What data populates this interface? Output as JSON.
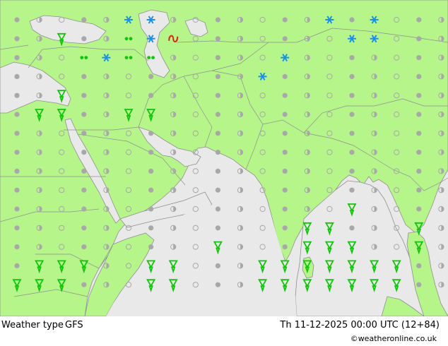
{
  "map": {
    "title": "Weather type",
    "model": "GFS",
    "valid_time": "Th 11-12-2025 00:00 UTC (12+84)",
    "copyright": "©weatheronline.co.uk",
    "colors": {
      "land": "#b6f58a",
      "sea": "#e9e9e9",
      "border": "#9a9a9a",
      "dot": "#a8a8a8",
      "rain": "#12c40c",
      "snow": "#1a8fe6",
      "thunder": "#d02b0b"
    },
    "symbol_legend": {
      "overcast": "filled-grey-dot",
      "cloudy": "half-grey-dot",
      "clear": "open-grey-circle",
      "rain": "green-raindrop-icon",
      "drizzle": "green-double-dot-icon",
      "snow": "blue-snowflake-icon",
      "thunder": "red-lightning-icon"
    }
  }
}
